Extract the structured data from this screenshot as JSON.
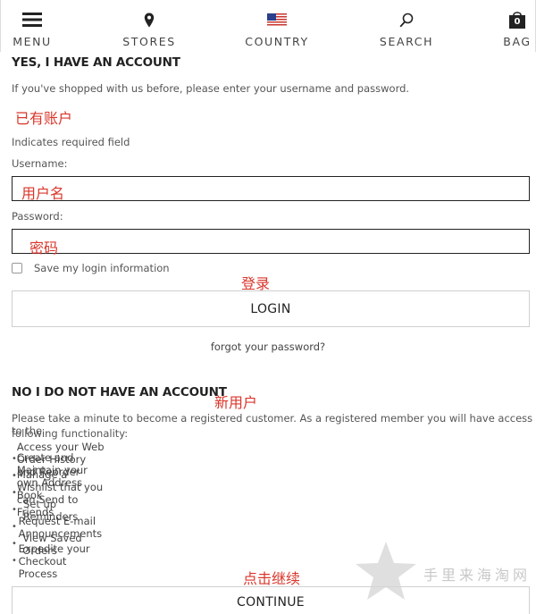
{
  "nav": {
    "menu": "MENU",
    "stores": "STORES",
    "country": "COUNTRY",
    "search": "SEARCH",
    "bag": "BAG",
    "bag_count": "0"
  },
  "account": {
    "heading": "YES, I HAVE AN ACCOUNT",
    "intro": "If you've shopped with us before, please enter your username and password.",
    "annotation_existing": "已有账户",
    "required_note": "Indicates required field",
    "username_label": "Username:",
    "annotation_username": "用户名",
    "password_label": "Password:",
    "annotation_password": "密码",
    "remember_label": "Save my login information",
    "annotation_login": "登录",
    "login_button": "LOGIN",
    "forgot_link": "forgot your password?"
  },
  "register": {
    "heading": "NO I DO NOT HAVE AN ACCOUNT",
    "annotation_new": "新用户",
    "intro_line1": "Please take a minute to become a registered customer.  As a registered member you will have access to the",
    "intro_line2": "following functionality:",
    "features": [
      "Access your Web Order History and Reorder",
      "Create and Maintain your own Address Book",
      "Manage a Wishlist that you can Send to Friends",
      "Set up Reminders",
      "Request E-mail Announcements",
      "View Saved Orders",
      "Expedite your Checkout Process"
    ],
    "annotation_continue": "点击继续",
    "continue_button": "CONTINUE"
  },
  "watermark": {
    "text": "手里来海淘网"
  },
  "colors": {
    "annotation_red": "#d9362b",
    "field_border": "#222222",
    "button_border": "#cfcfcf"
  }
}
